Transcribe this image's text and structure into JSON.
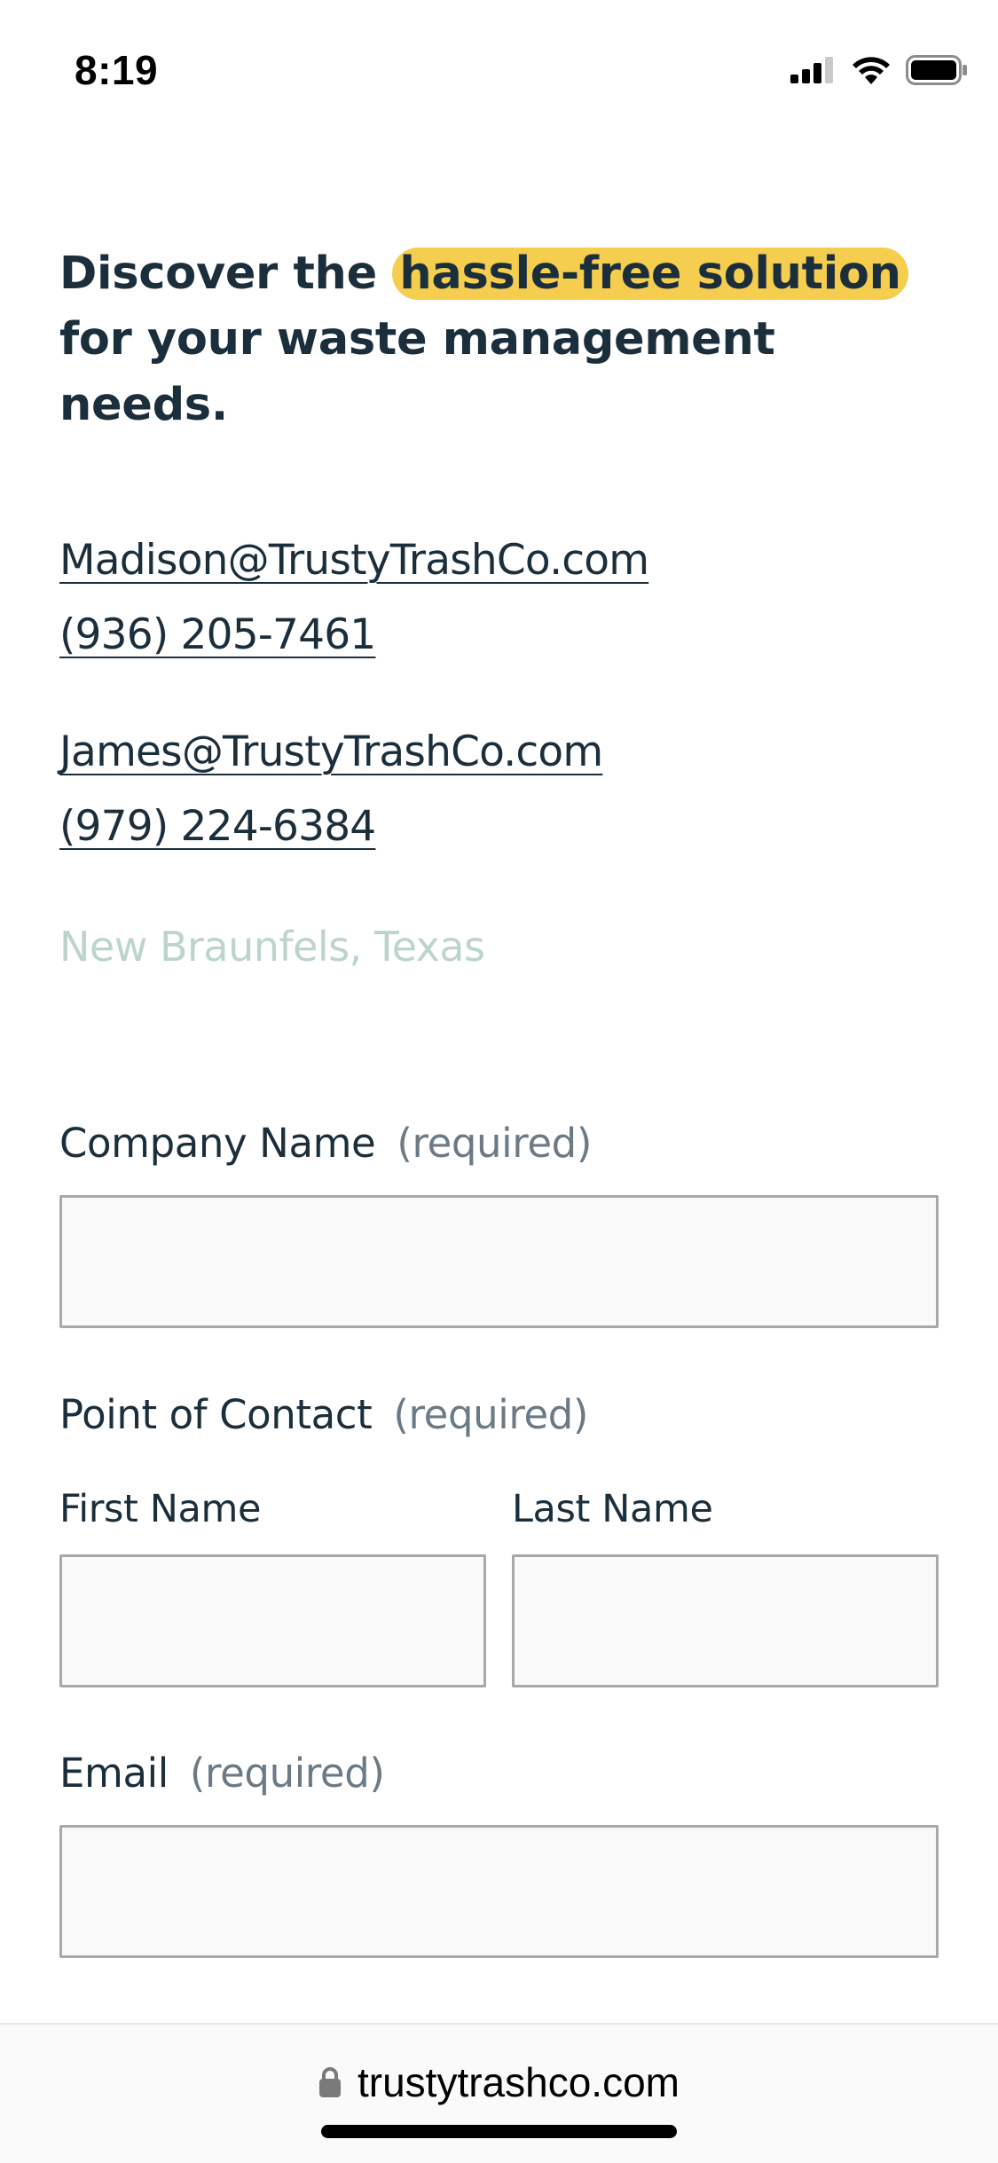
{
  "status_bar": {
    "time": "8:19",
    "icons": [
      "cellular-signal-icon",
      "wifi-icon",
      "battery-icon"
    ]
  },
  "hero": {
    "headline_before": "Discover the ",
    "headline_highlight": "hassle-free solution",
    "headline_after": " for your waste management needs.",
    "highlight_color": "#f5ce4f"
  },
  "contacts": [
    {
      "email": "Madison@TrustyTrashCo.com",
      "phone": "(936) 205-7461"
    },
    {
      "email": "James@TrustyTrashCo.com",
      "phone": "(979) 224-6384"
    }
  ],
  "location": "New Braunfels, Texas",
  "form": {
    "company": {
      "label": "Company Name",
      "required": "(required)",
      "value": ""
    },
    "contact": {
      "label": "Point of Contact",
      "required": "(required)",
      "first_label": "First Name",
      "last_label": "Last Name",
      "first_value": "",
      "last_value": ""
    },
    "email": {
      "label": "Email",
      "required": "(required)",
      "value": ""
    }
  },
  "browser": {
    "url": "trustytrashco.com",
    "lock_icon": "lock-icon"
  },
  "colors": {
    "text": "#1b2e3c",
    "muted": "#6a7a86",
    "location": "#bcd5cb",
    "input_bg": "#f9f9f9",
    "input_border": "#a8a8a8"
  }
}
